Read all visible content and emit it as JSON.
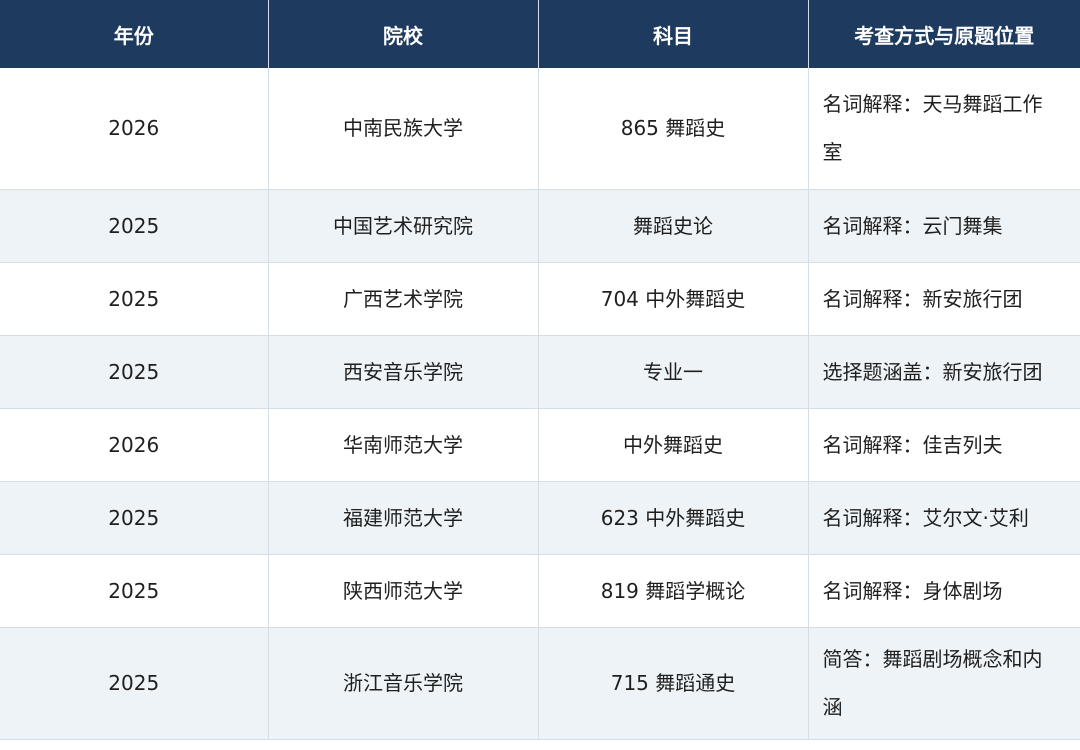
{
  "table": {
    "headers": [
      "年份",
      "院校",
      "科目",
      "考查方式与原题位置"
    ],
    "rows": [
      {
        "year": "2026",
        "school": "中南民族大学",
        "subject": "865 舞蹈史",
        "detail": "名词解释：天马舞蹈工作室"
      },
      {
        "year": "2025",
        "school": "中国艺术研究院",
        "subject": "舞蹈史论",
        "detail": "名词解释：云门舞集"
      },
      {
        "year": "2025",
        "school": "广西艺术学院",
        "subject": "704 中外舞蹈史",
        "detail": "名词解释：新安旅行团"
      },
      {
        "year": "2025",
        "school": "西安音乐学院",
        "subject": "专业一",
        "detail": "选择题涵盖：新安旅行团"
      },
      {
        "year": "2026",
        "school": "华南师范大学",
        "subject": "中外舞蹈史",
        "detail": "名词解释：佳吉列夫"
      },
      {
        "year": "2025",
        "school": "福建师范大学",
        "subject": "623 中外舞蹈史",
        "detail": "名词解释：艾尔文·艾利"
      },
      {
        "year": "2025",
        "school": "陕西师范大学",
        "subject": "819 舞蹈学概论",
        "detail": "名词解释：身体剧场"
      },
      {
        "year": "2025",
        "school": "浙江音乐学院",
        "subject": "715 舞蹈通史",
        "detail": "简答：舞蹈剧场概念和内涵"
      }
    ]
  },
  "colors": {
    "header_bg": "#1e3a5f",
    "header_text": "#ffffff",
    "row_alt_bg": "#eef3f7",
    "border": "#d5dde6"
  }
}
